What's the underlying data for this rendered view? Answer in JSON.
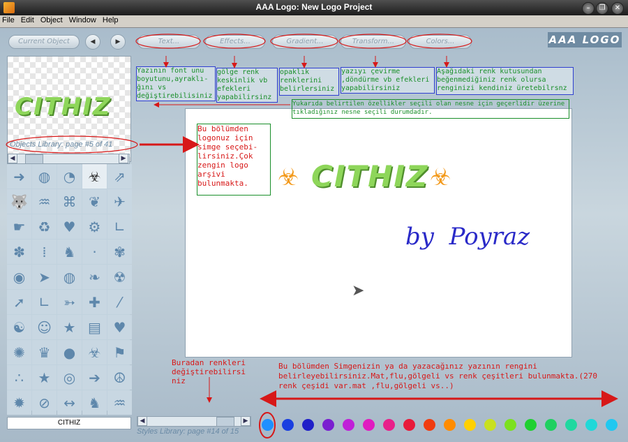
{
  "window": {
    "title": "AAA Logo: New Logo Project"
  },
  "menu": [
    "File",
    "Edit",
    "Object",
    "Window",
    "Help"
  ],
  "toolbar": {
    "current_object": "Current Object",
    "tabs": [
      "Text...",
      "Effects...",
      "Gradient...",
      "Transform...",
      "Colors..."
    ],
    "brand": "AAA LOGO"
  },
  "preview": {
    "logo_text": "CITHIZ"
  },
  "objects_library": {
    "caption": "Objects Library: page #5 of 41"
  },
  "object_name": "CITHIZ",
  "styles_library": {
    "caption": "Styles Library: page #14 of 15"
  },
  "canvas": {
    "logo_text": "CITHIZ",
    "byline": "by  Poyraz"
  },
  "annotations": {
    "a1": "Yazının font unu boyutunu,ayraklı-ğını vs değiştirebilisiniz",
    "a2": "gölge renk keskinlik vb efekleri yapabilirsinz",
    "a3": "opaklık renklerini belirlersiniz",
    "a4": "yazıyı çevirme ,döndürme vb efekleri yapabilirsiniz",
    "a5": "Aşağıdaki renk kutusundan beğenmediğiniz renk olursa renginizi kendiniz üretebilrsnz",
    "a6": "Yukarıda belirtilen özellikler seçili olan nesne için geçerlidir üzerine tıkladığınız nesne seçili durumdadır.",
    "a7": "Bu bölümden logonuz için simge seçebi-lirsiniz.Çok zengin logo arşivi bulunmakta.",
    "a8": "Buradan renkleri değiştirebilirsi niz",
    "a9": "Bu bölümden Simgenizin ya da yazacağınız yazının rengini belirleyebilirsiniz.Mat,flu,gölgeli vs renk çeşitleri bulunmakta.(270 renk çeşidi var.mat ,flu,gölgeli vs..)"
  },
  "library_icons": [
    "arrow-right-icon",
    "bars-circle-icon",
    "quarter-circle-icon",
    "biohazard-icon",
    "double-arrow-icon",
    "wolf-icon",
    "bat-icon",
    "symbol-icon",
    "leaf-icon",
    "bird-icon",
    "hand-point-icon",
    "recycle-icon",
    "heart-circle-icon",
    "gear-icon",
    "l-shape-icon",
    "ornament-icon",
    "bar-icon",
    "cat-icon",
    "tiny-icon",
    "flower-icon",
    "square-circle-icon",
    "arrow-diamond-icon",
    "globe-icon",
    "leaf2-icon",
    "radiation-icon",
    "arrow-up-right-icon",
    "foot-icon",
    "fish-icon",
    "plus-icon",
    "slash-icon",
    "swirl-icon",
    "face-icon",
    "star-icon",
    "squares-icon",
    "heart-small-icon",
    "sun-icon",
    "crown-icon",
    "circle-icon",
    "biohazard2-icon",
    "flag-icon",
    "dots-icon",
    "star-small-icon",
    "square-in-circle-icon",
    "arrow-right2-icon",
    "peace-icon",
    "starburst-icon",
    "no-sign-icon",
    "arrow-line-icon",
    "tiger-icon",
    "bat2-icon"
  ],
  "library_glyphs": [
    "➜",
    "◍",
    "◔",
    "☣",
    "⇗",
    "🐺",
    "♒",
    "⌘",
    "❦",
    "✈",
    "☛",
    "♻",
    "♥",
    "⚙",
    "∟",
    "✽",
    "⁞",
    "♞",
    "·",
    "✾",
    "◉",
    "➤",
    "◍",
    "❧",
    "☢",
    "➚",
    "∟",
    "➳",
    "✚",
    "⁄",
    "☯",
    "☺",
    "★",
    "▤",
    "♥",
    "✺",
    "♛",
    "●",
    "☣",
    "⚑",
    "∴",
    "★",
    "◎",
    "➔",
    "☮",
    "✹",
    "⊘",
    "↔",
    "♞",
    "♒"
  ],
  "swatches": [
    "#1e90ff",
    "#1a3fe0",
    "#2020c8",
    "#7a1fd0",
    "#c020d8",
    "#e01cc0",
    "#e8208a",
    "#e81a3a",
    "#f03c10",
    "#ff8c00",
    "#ffd000",
    "#c8e020",
    "#7ce020",
    "#20d030",
    "#20d060",
    "#20d8a0",
    "#20d8d8",
    "#20c8f0"
  ],
  "colors": {
    "accent_red": "#d71818",
    "annotation_green": "#1a8f2a",
    "annotation_blue": "#2f3fd0",
    "logo_green": "#8ed65a",
    "byline_blue": "#2a2ac8"
  }
}
